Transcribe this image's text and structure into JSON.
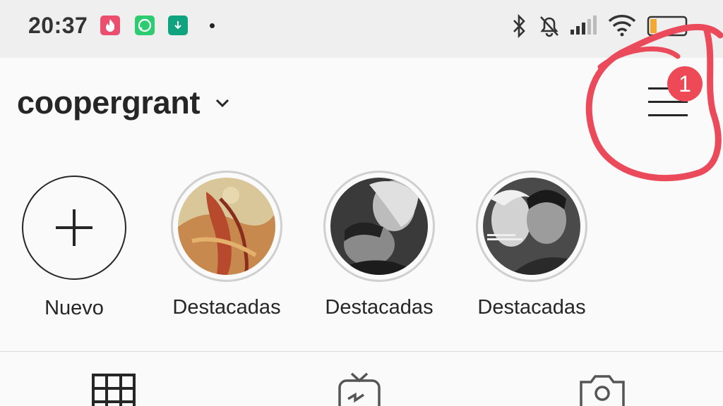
{
  "status_bar": {
    "time": "20:37",
    "battery": "33",
    "icons": [
      "tinder-icon",
      "whatsapp-icon",
      "download-icon",
      "bluetooth-icon",
      "mute-icon",
      "signal-icon",
      "wifi-icon",
      "battery-icon"
    ]
  },
  "header": {
    "username": "coopergrant",
    "notification_count": "1"
  },
  "highlights": [
    {
      "label": "Nuevo"
    },
    {
      "label": "Destacadas"
    },
    {
      "label": "Destacadas"
    },
    {
      "label": "Destacadas"
    }
  ],
  "tabs": [
    "grid-icon",
    "igtv-icon",
    "tagged-icon"
  ],
  "colors": {
    "badge": "#ed4956",
    "annotation": "#ea4a5a",
    "text": "#262626"
  }
}
